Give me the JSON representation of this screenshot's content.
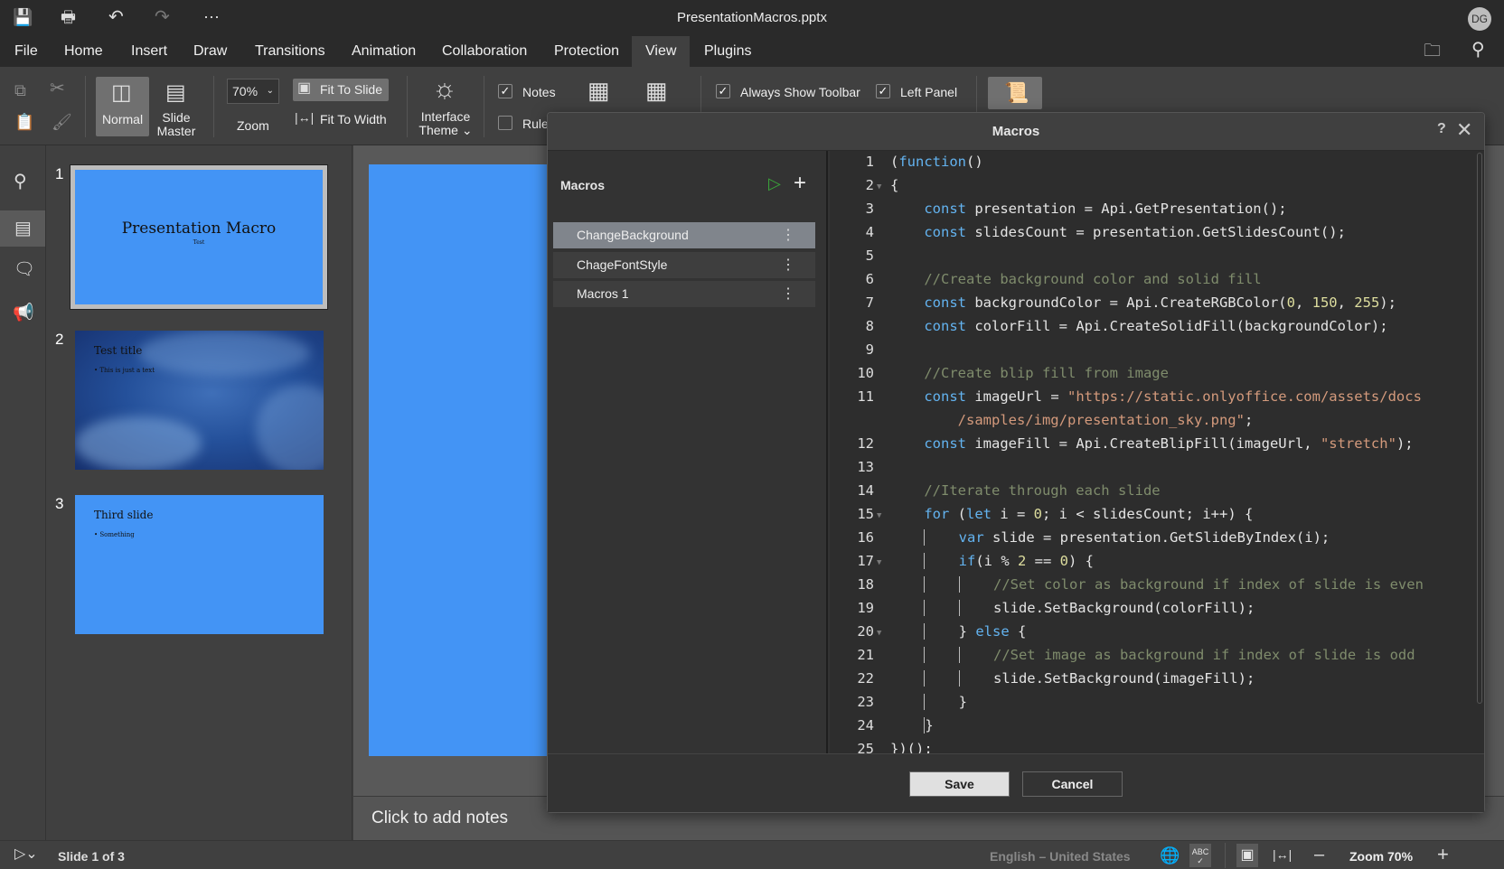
{
  "title": "PresentationMacros.pptx",
  "user_initials": "DG",
  "menu": [
    "File",
    "Home",
    "Insert",
    "Draw",
    "Transitions",
    "Animation",
    "Collaboration",
    "Protection",
    "View",
    "Plugins"
  ],
  "active_menu": "View",
  "toolbar": {
    "normal": "Normal",
    "slide_master_1": "Slide",
    "slide_master_2": "Master",
    "zoom_value": "70%",
    "zoom_label": "Zoom",
    "fit_to_slide": "Fit To Slide",
    "fit_to_width": "Fit To Width",
    "interface_theme_1": "Interface",
    "interface_theme_2": "Theme",
    "notes": "Notes",
    "notes_checked": true,
    "rulers": "Rulers",
    "rulers_checked": false,
    "always_show_toolbar": "Always Show Toolbar",
    "always_show_toolbar_checked": true,
    "left_panel": "Left Panel",
    "left_panel_checked": true
  },
  "slides": [
    {
      "number": "1",
      "title": "Presentation Macro",
      "subtitle": "Test"
    },
    {
      "number": "2",
      "title": "Test title",
      "bullet": "• This is just a text"
    },
    {
      "number": "3",
      "title": "Third slide",
      "bullet": "• Something"
    }
  ],
  "notes_placeholder": "Click to add notes",
  "status": {
    "slide_info": "Slide 1 of 3",
    "language": "English – United States",
    "zoom": "Zoom 70%"
  },
  "dialog": {
    "title": "Macros",
    "help": "?",
    "list_title": "Macros",
    "macros": [
      "ChangeBackground",
      "ChageFontStyle",
      "Macros 1"
    ],
    "selected": 0,
    "save": "Save",
    "cancel": "Cancel"
  },
  "colors": {
    "slide_blue": "#4394f5",
    "keyword": "#63b3f0",
    "comment": "#7f8c6c",
    "string": "#d49a7c",
    "number": "#dede9e",
    "run_icon": "#3aa53a"
  },
  "code_lines": [
    {
      "n": "1",
      "t": [
        [
          "p",
          "("
        ],
        [
          "kw",
          "function"
        ],
        [
          "p",
          "()"
        ]
      ]
    },
    {
      "n": "2",
      "fold": true,
      "t": [
        [
          "p",
          "{"
        ]
      ]
    },
    {
      "n": "3",
      "t": [
        [
          "p",
          "    "
        ],
        [
          "kw",
          "const"
        ],
        [
          "p",
          " presentation = Api.GetPresentation();"
        ]
      ]
    },
    {
      "n": "4",
      "t": [
        [
          "p",
          "    "
        ],
        [
          "kw",
          "const"
        ],
        [
          "p",
          " slidesCount = presentation.GetSlidesCount();"
        ]
      ]
    },
    {
      "n": "5",
      "t": []
    },
    {
      "n": "6",
      "t": [
        [
          "p",
          "    "
        ],
        [
          "cm",
          "//Create background color and solid fill"
        ]
      ]
    },
    {
      "n": "7",
      "t": [
        [
          "p",
          "    "
        ],
        [
          "kw",
          "const"
        ],
        [
          "p",
          " backgroundColor = Api.CreateRGBColor("
        ],
        [
          "nu",
          "0"
        ],
        [
          "p",
          ", "
        ],
        [
          "nu",
          "150"
        ],
        [
          "p",
          ", "
        ],
        [
          "nu",
          "255"
        ],
        [
          "p",
          ");"
        ]
      ]
    },
    {
      "n": "8",
      "t": [
        [
          "p",
          "    "
        ],
        [
          "kw",
          "const"
        ],
        [
          "p",
          " colorFill = Api.CreateSolidFill(backgroundColor);"
        ]
      ]
    },
    {
      "n": "9",
      "t": []
    },
    {
      "n": "10",
      "t": [
        [
          "p",
          "    "
        ],
        [
          "cm",
          "//Create blip fill from image"
        ]
      ]
    },
    {
      "n": "11",
      "t": [
        [
          "p",
          "    "
        ],
        [
          "kw",
          "const"
        ],
        [
          "p",
          " imageUrl = "
        ],
        [
          "st",
          "\"https://static.onlyoffice.com/assets/docs"
        ]
      ]
    },
    {
      "n": "",
      "t": [
        [
          "p",
          "        "
        ],
        [
          "st",
          "/samples/img/presentation_sky.png\""
        ],
        [
          "p",
          ";"
        ]
      ]
    },
    {
      "n": "12",
      "t": [
        [
          "p",
          "    "
        ],
        [
          "kw",
          "const"
        ],
        [
          "p",
          " imageFill = Api.CreateBlipFill(imageUrl, "
        ],
        [
          "st",
          "\"stretch\""
        ],
        [
          "p",
          ");"
        ]
      ]
    },
    {
      "n": "13",
      "t": []
    },
    {
      "n": "14",
      "t": [
        [
          "p",
          "    "
        ],
        [
          "cm",
          "//Iterate through each slide"
        ]
      ]
    },
    {
      "n": "15",
      "fold": true,
      "t": [
        [
          "p",
          "    "
        ],
        [
          "kw",
          "for"
        ],
        [
          "p",
          " ("
        ],
        [
          "kw",
          "let"
        ],
        [
          "p",
          " i = "
        ],
        [
          "nu",
          "0"
        ],
        [
          "p",
          "; i < slidesCount; i++) {"
        ]
      ]
    },
    {
      "n": "16",
      "t": [
        [
          "p",
          "    "
        ],
        [
          "g",
          "    "
        ],
        [
          "kw",
          "var"
        ],
        [
          "p",
          " slide = presentation.GetSlideByIndex(i);"
        ]
      ]
    },
    {
      "n": "17",
      "fold": true,
      "t": [
        [
          "p",
          "    "
        ],
        [
          "g",
          "    "
        ],
        [
          "kw",
          "if"
        ],
        [
          "p",
          "(i % "
        ],
        [
          "nu",
          "2"
        ],
        [
          "p",
          " == "
        ],
        [
          "nu",
          "0"
        ],
        [
          "p",
          ") {"
        ]
      ]
    },
    {
      "n": "18",
      "t": [
        [
          "p",
          "    "
        ],
        [
          "g",
          "    "
        ],
        [
          "g",
          "    "
        ],
        [
          "cm",
          "//Set color as background if index of slide is even"
        ]
      ]
    },
    {
      "n": "19",
      "t": [
        [
          "p",
          "    "
        ],
        [
          "g",
          "    "
        ],
        [
          "g",
          "    "
        ],
        [
          "p",
          "slide.SetBackground(colorFill);"
        ]
      ]
    },
    {
      "n": "20",
      "fold": true,
      "t": [
        [
          "p",
          "    "
        ],
        [
          "g",
          "    "
        ],
        [
          "p",
          "} "
        ],
        [
          "kw",
          "else"
        ],
        [
          "p",
          " {"
        ]
      ]
    },
    {
      "n": "21",
      "t": [
        [
          "p",
          "    "
        ],
        [
          "g",
          "    "
        ],
        [
          "g",
          "    "
        ],
        [
          "cm",
          "//Set image as background if index of slide is odd"
        ]
      ]
    },
    {
      "n": "22",
      "t": [
        [
          "p",
          "    "
        ],
        [
          "g",
          "    "
        ],
        [
          "g",
          "    "
        ],
        [
          "p",
          "slide.SetBackground(imageFill);"
        ]
      ]
    },
    {
      "n": "23",
      "t": [
        [
          "p",
          "    "
        ],
        [
          "g",
          "    "
        ],
        [
          "p",
          "}"
        ]
      ]
    },
    {
      "n": "24",
      "t": [
        [
          "p",
          "    "
        ],
        [
          "g",
          ""
        ],
        [
          "p",
          "}"
        ]
      ]
    },
    {
      "n": "25",
      "t": [
        [
          "p",
          "})();"
        ]
      ]
    }
  ]
}
